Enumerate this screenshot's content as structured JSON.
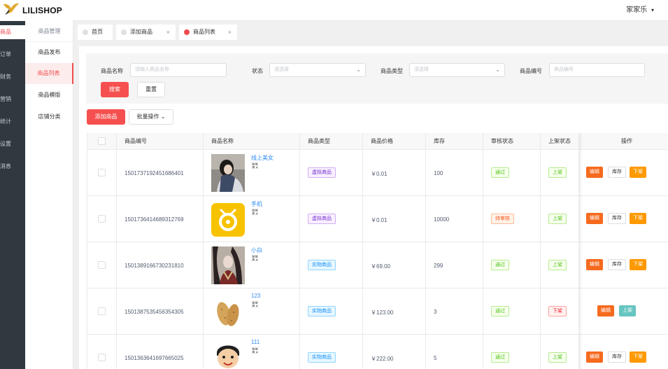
{
  "app": {
    "logo_text": "LILISHOP"
  },
  "leftnav": {
    "items": [
      {
        "label": "商品",
        "active": true
      },
      {
        "label": "订单"
      },
      {
        "label": "财务"
      },
      {
        "label": "营销"
      },
      {
        "label": "统计"
      },
      {
        "label": "设置"
      },
      {
        "label": "消息"
      }
    ]
  },
  "submenu": {
    "title": "商品管理",
    "items": [
      {
        "label": "商品发布"
      },
      {
        "label": "商品列表",
        "active": true
      },
      {
        "label": "商品模版"
      },
      {
        "label": "店铺分类"
      }
    ]
  },
  "header": {
    "user": "家家乐",
    "user_caret": "▾"
  },
  "tabs": [
    {
      "label": "首页",
      "closable": false
    },
    {
      "label": "添加商品",
      "closable": true
    },
    {
      "label": "商品列表",
      "closable": true,
      "active": true
    }
  ],
  "tab_close_glyph": "×",
  "search": {
    "name_label": "商品名称",
    "name_placeholder": "请输入商品名称",
    "status_label": "状态",
    "status_placeholder": "请选择",
    "type_label": "商品类型",
    "type_placeholder": "请选择",
    "code_label": "商品编号",
    "code_placeholder": "商品编号",
    "search_button": "搜索",
    "reset_button": "重置",
    "chevron": "⌄"
  },
  "toolbar": {
    "add_button": "添加商品",
    "batch_button": "批量操作 ⌄"
  },
  "table": {
    "headers": [
      "商品编号",
      "商品名称",
      "商品类型",
      "商品价格",
      "库存",
      "审核状态",
      "上架状态",
      "操作"
    ],
    "rows": [
      {
        "id": "1501737192451686401",
        "name": "线上美女",
        "type": "虚拟商品",
        "type_color": "purple",
        "price": "￥0.01",
        "stock": "100",
        "audit": "通过",
        "audit_color": "green",
        "shelf": "上架",
        "shelf_color": "green",
        "thumb": "woman",
        "actions": [
          "编辑",
          "库存",
          "下架"
        ]
      },
      {
        "id": "1501736414689312769",
        "name": "手机",
        "type": "虚拟商品",
        "type_color": "purple",
        "price": "￥0.01",
        "stock": "10000",
        "audit": "待审核",
        "audit_color": "orange",
        "shelf": "上架",
        "shelf_color": "green",
        "thumb": "yellow-logo",
        "actions": [
          "编辑",
          "库存",
          "下架"
        ]
      },
      {
        "id": "1501389166730231810",
        "name": "小白",
        "type": "实物商品",
        "type_color": "blue",
        "price": "￥69.00",
        "stock": "299",
        "audit": "通过",
        "audit_color": "green",
        "shelf": "上架",
        "shelf_color": "green",
        "thumb": "costume",
        "actions": [
          "编辑",
          "库存",
          "下架"
        ]
      },
      {
        "id": "1501387535456354305",
        "name": "123",
        "type": "实物商品",
        "type_color": "blue",
        "price": "￥123.00",
        "stock": "3",
        "audit": "通过",
        "audit_color": "green",
        "shelf": "下架",
        "shelf_color": "red",
        "thumb": "potato",
        "actions": [
          "编辑",
          "上架"
        ]
      },
      {
        "id": "1501363641697665025",
        "name": "111",
        "type": "实物商品",
        "type_color": "blue",
        "price": "￥222.00",
        "stock": "5",
        "audit": "通过",
        "audit_color": "green",
        "shelf": "上架",
        "shelf_color": "green",
        "thumb": "cartoon",
        "actions": [
          "编辑",
          "库存",
          "下架"
        ]
      }
    ]
  }
}
